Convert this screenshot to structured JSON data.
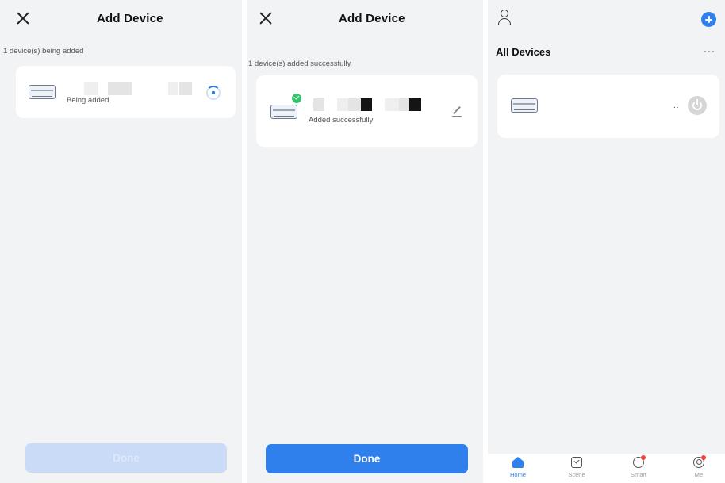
{
  "panel1": {
    "title": "Add Device",
    "status_note": "1 device(s) being added",
    "device": {
      "status": "Being added",
      "icon": "air-conditioner-icon"
    },
    "done_label": "Done",
    "done_enabled": false
  },
  "panel2": {
    "title": "Add Device",
    "status_note": "1 device(s) added successfully",
    "device": {
      "status": "Added successfully",
      "icon": "air-conditioner-icon"
    },
    "done_label": "Done",
    "done_enabled": true
  },
  "panel3": {
    "section_title": "All Devices",
    "more": "···",
    "device": {
      "icon": "air-conditioner-icon",
      "name_dots": ".."
    },
    "tabs": [
      {
        "label": "Home",
        "icon": "home-icon",
        "active": true
      },
      {
        "label": "Scene",
        "icon": "scene-icon",
        "active": false
      },
      {
        "label": "Smart",
        "icon": "smart-icon",
        "active": false
      },
      {
        "label": "Me",
        "icon": "me-icon",
        "active": false
      }
    ]
  },
  "colors": {
    "accent": "#2f80ed",
    "success": "#31c26a",
    "badge": "#f04438",
    "background": "#f2f3f5"
  }
}
